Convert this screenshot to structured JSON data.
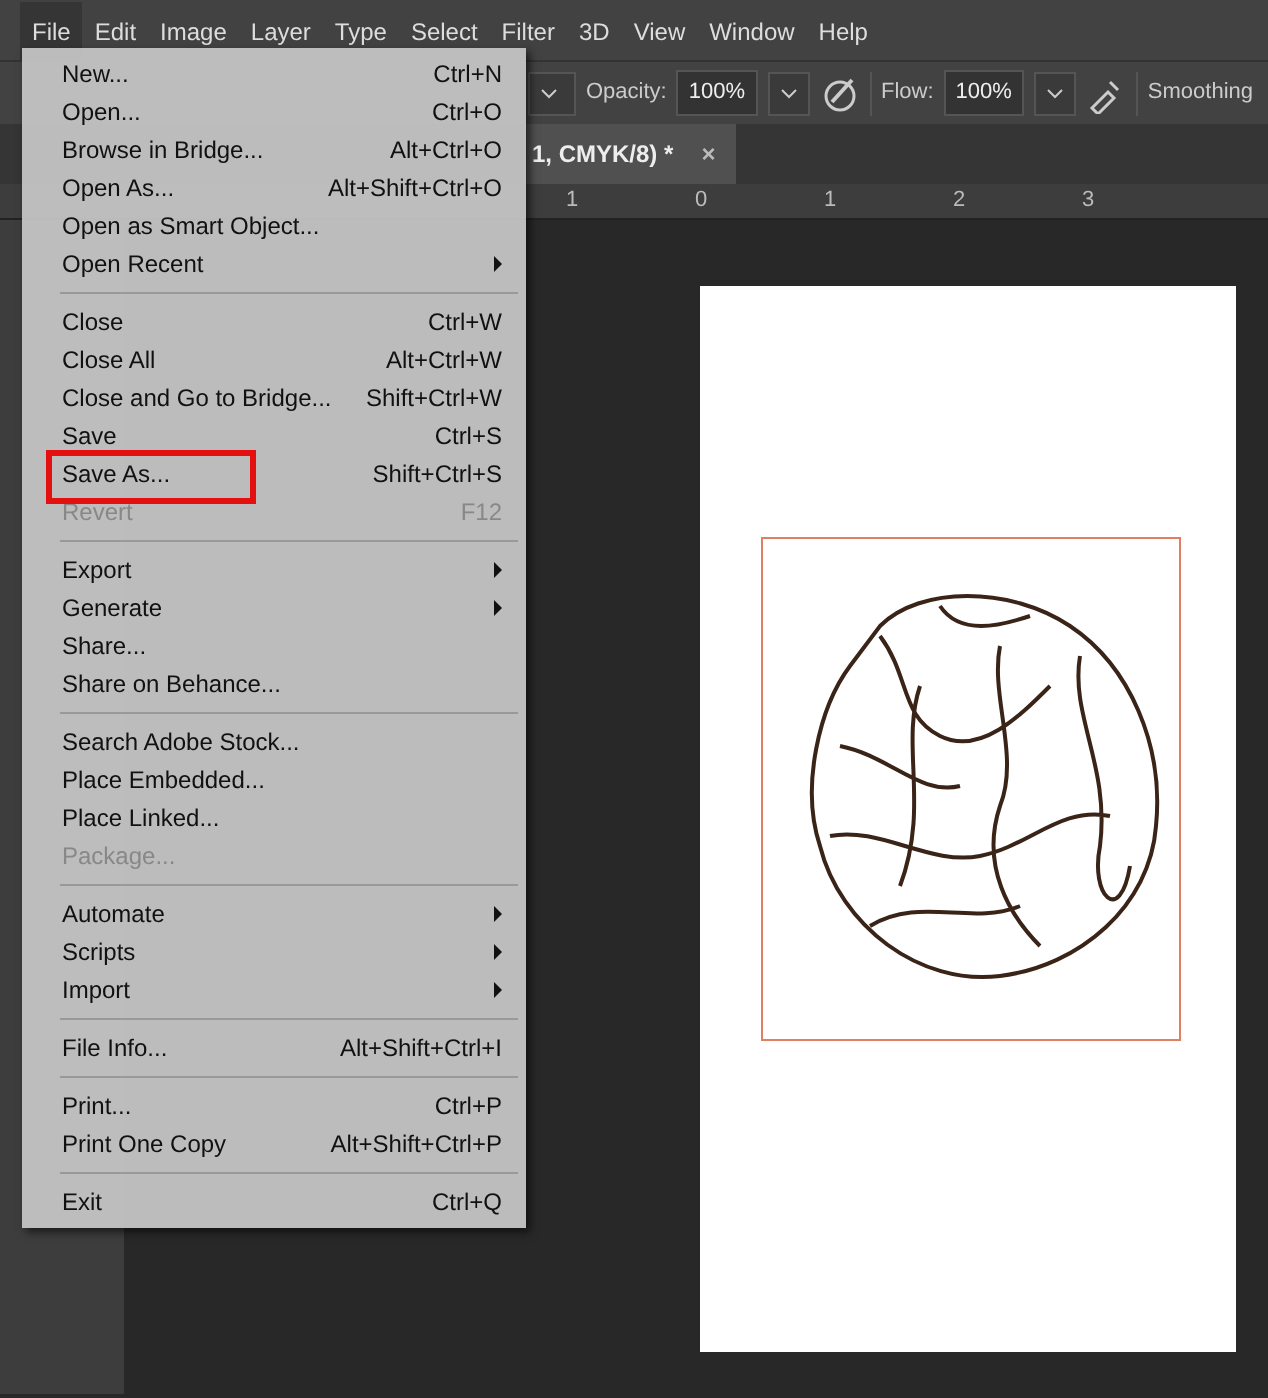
{
  "menu_bar": [
    {
      "label": "File",
      "selected": true
    },
    {
      "label": "Edit",
      "selected": false
    },
    {
      "label": "Image",
      "selected": false
    },
    {
      "label": "Layer",
      "selected": false
    },
    {
      "label": "Type",
      "selected": false
    },
    {
      "label": "Select",
      "selected": false
    },
    {
      "label": "Filter",
      "selected": false
    },
    {
      "label": "3D",
      "selected": false
    },
    {
      "label": "View",
      "selected": false
    },
    {
      "label": "Window",
      "selected": false
    },
    {
      "label": "Help",
      "selected": false
    }
  ],
  "options_bar": {
    "opacity_label": "Opacity:",
    "opacity": "100%",
    "flow_label": "Flow:",
    "flow": "100%",
    "smoothing_label": "Smoothing"
  },
  "document_tab": {
    "title": "1, CMYK/8) *",
    "close": "×"
  },
  "ruler": [
    "1",
    "0",
    "1",
    "2",
    "3"
  ],
  "file_menu": [
    {
      "kind": "item",
      "label": "New...",
      "shortcut": "Ctrl+N",
      "submenu": false,
      "disabled": false,
      "highlighted": false
    },
    {
      "kind": "item",
      "label": "Open...",
      "shortcut": "Ctrl+O",
      "submenu": false,
      "disabled": false,
      "highlighted": false
    },
    {
      "kind": "item",
      "label": "Browse in Bridge...",
      "shortcut": "Alt+Ctrl+O",
      "submenu": false,
      "disabled": false,
      "highlighted": false
    },
    {
      "kind": "item",
      "label": "Open As...",
      "shortcut": "Alt+Shift+Ctrl+O",
      "submenu": false,
      "disabled": false,
      "highlighted": false
    },
    {
      "kind": "item",
      "label": "Open as Smart Object...",
      "submenu": false,
      "disabled": false,
      "highlighted": false
    },
    {
      "kind": "item",
      "label": "Open Recent",
      "submenu": true,
      "disabled": false,
      "highlighted": false
    },
    {
      "kind": "separator"
    },
    {
      "kind": "item",
      "label": "Close",
      "shortcut": "Ctrl+W",
      "submenu": false,
      "disabled": false,
      "highlighted": false
    },
    {
      "kind": "item",
      "label": "Close All",
      "shortcut": "Alt+Ctrl+W",
      "submenu": false,
      "disabled": false,
      "highlighted": false
    },
    {
      "kind": "item",
      "label": "Close and Go to Bridge...",
      "shortcut": "Shift+Ctrl+W",
      "submenu": false,
      "disabled": false,
      "highlighted": false
    },
    {
      "kind": "item",
      "label": "Save",
      "shortcut": "Ctrl+S",
      "submenu": false,
      "disabled": false,
      "highlighted": false
    },
    {
      "kind": "item",
      "label": "Save As...",
      "shortcut": "Shift+Ctrl+S",
      "submenu": false,
      "disabled": false,
      "highlighted": true
    },
    {
      "kind": "item",
      "label": "Revert",
      "shortcut": "F12",
      "submenu": false,
      "disabled": true,
      "highlighted": false
    },
    {
      "kind": "separator"
    },
    {
      "kind": "item",
      "label": "Export",
      "submenu": true,
      "disabled": false,
      "highlighted": false
    },
    {
      "kind": "item",
      "label": "Generate",
      "submenu": true,
      "disabled": false,
      "highlighted": false
    },
    {
      "kind": "item",
      "label": "Share...",
      "submenu": false,
      "disabled": false,
      "highlighted": false
    },
    {
      "kind": "item",
      "label": "Share on Behance...",
      "submenu": false,
      "disabled": false,
      "highlighted": false
    },
    {
      "kind": "separator"
    },
    {
      "kind": "item",
      "label": "Search Adobe Stock...",
      "submenu": false,
      "disabled": false,
      "highlighted": false
    },
    {
      "kind": "item",
      "label": "Place Embedded...",
      "submenu": false,
      "disabled": false,
      "highlighted": false
    },
    {
      "kind": "item",
      "label": "Place Linked...",
      "submenu": false,
      "disabled": false,
      "highlighted": false
    },
    {
      "kind": "item",
      "label": "Package...",
      "submenu": false,
      "disabled": true,
      "highlighted": false
    },
    {
      "kind": "separator"
    },
    {
      "kind": "item",
      "label": "Automate",
      "submenu": true,
      "disabled": false,
      "highlighted": false
    },
    {
      "kind": "item",
      "label": "Scripts",
      "submenu": true,
      "disabled": false,
      "highlighted": false
    },
    {
      "kind": "item",
      "label": "Import",
      "submenu": true,
      "disabled": false,
      "highlighted": false
    },
    {
      "kind": "separator"
    },
    {
      "kind": "item",
      "label": "File Info...",
      "shortcut": "Alt+Shift+Ctrl+I",
      "submenu": false,
      "disabled": false,
      "highlighted": false
    },
    {
      "kind": "separator"
    },
    {
      "kind": "item",
      "label": "Print...",
      "shortcut": "Ctrl+P",
      "submenu": false,
      "disabled": false,
      "highlighted": false
    },
    {
      "kind": "item",
      "label": "Print One Copy",
      "shortcut": "Alt+Shift+Ctrl+P",
      "submenu": false,
      "disabled": false,
      "highlighted": false
    },
    {
      "kind": "separator"
    },
    {
      "kind": "item",
      "label": "Exit",
      "shortcut": "Ctrl+Q",
      "submenu": false,
      "disabled": false,
      "highlighted": false
    }
  ]
}
